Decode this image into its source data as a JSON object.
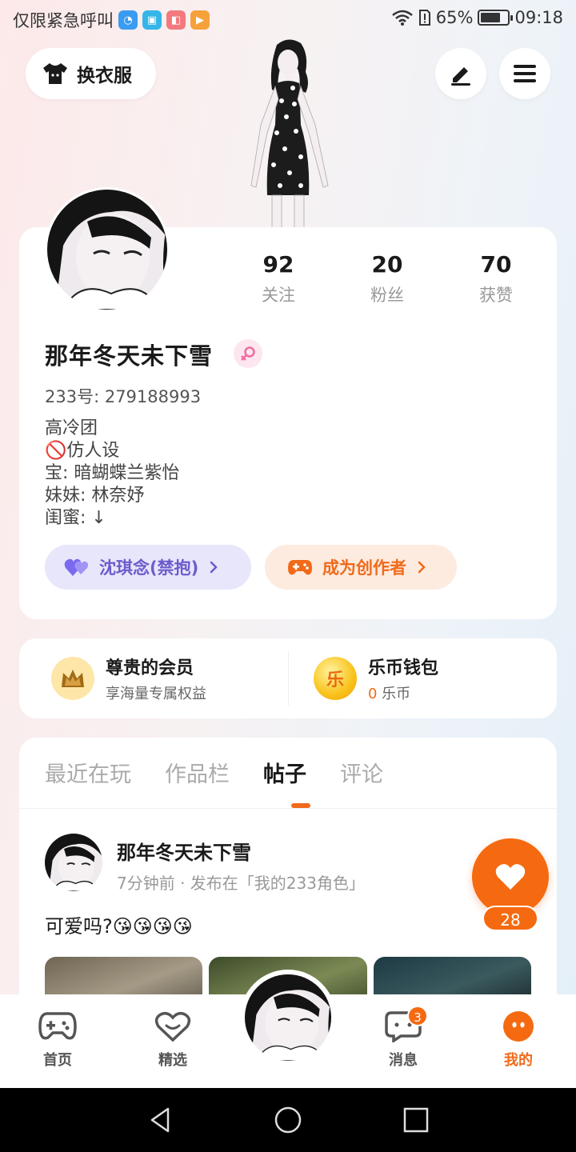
{
  "status_bar": {
    "carrier_text": "仅限紧急呼叫",
    "battery": "65%",
    "time": "09:18"
  },
  "header": {
    "outfit_label": "换衣服"
  },
  "profile": {
    "stats": [
      {
        "value": "92",
        "label": "关注"
      },
      {
        "value": "20",
        "label": "粉丝"
      },
      {
        "value": "70",
        "label": "获赞"
      }
    ],
    "nickname": "那年冬天未下雪",
    "user_id": "233号: 279188993",
    "bio": [
      "高冷团",
      "🚫仿人设",
      "宝: 暗蝴蝶兰紫怡",
      "妹妹: 林奈妤",
      "闺蜜: ↓"
    ],
    "guard_pill": "沈琪念(禁抱)",
    "creator_pill": "成为创作者"
  },
  "member": {
    "vip_title": "尊贵的会员",
    "vip_sub": "享海量专属权益",
    "wallet_title": "乐币钱包",
    "wallet_amount": "0",
    "wallet_unit": " 乐币",
    "coin_glyph": "乐"
  },
  "feed": {
    "tabs": [
      "最近在玩",
      "作品栏",
      "帖子",
      "评论"
    ],
    "active_tab": 2,
    "post": {
      "author": "那年冬天未下雪",
      "meta": "7分钟前 · 发布在「我的233角色」",
      "text": "可爱吗?😘😘😘😘"
    },
    "like_count": "28"
  },
  "bottom_nav": {
    "items": [
      {
        "label": "首页",
        "icon": "gamepad-icon"
      },
      {
        "label": "精选",
        "icon": "heart-outline-icon"
      },
      {
        "label": "消息",
        "icon": "chat-icon"
      },
      {
        "label": "我的",
        "icon": "profile-dots-icon"
      }
    ],
    "message_badge": "3"
  },
  "colors": {
    "accent": "#f06a1a",
    "guard": "#6b5ccc"
  }
}
